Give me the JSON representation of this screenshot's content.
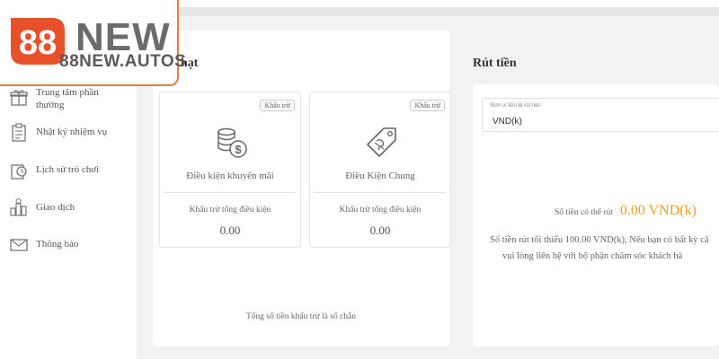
{
  "logo": {
    "number": "88",
    "word": "NEW",
    "domain": "88NEW.AUTOS",
    "brand_color": "#e8502a"
  },
  "sidebar": {
    "items": [
      {
        "label": "Trung tâm phần thưởng",
        "icon": "gift-icon"
      },
      {
        "label": "Nhật ký nhiệm vụ",
        "icon": "clipboard-icon"
      },
      {
        "label": "Lịch sử trò chơi",
        "icon": "history-icon"
      },
      {
        "label": "Giao dịch",
        "icon": "transaction-icon"
      },
      {
        "label": "Thông báo",
        "icon": "mail-icon"
      }
    ]
  },
  "left_panel": {
    "title_fragment": "hạt",
    "cards": [
      {
        "tag": "Khấu trừ",
        "title": "Điều kiện khuyến mãi",
        "sub": "Khấu trừ tổng điều kiện",
        "value": "0.00",
        "icon": "coins-dollar-icon"
      },
      {
        "tag": "Khấu trừ",
        "title": "Điều Kiện Chung",
        "sub": "Khấu trừ tổng điều kiện",
        "value": "0.00",
        "icon": "price-tag-icon"
      }
    ],
    "footnote": "Tổng số tiền khấu trừ là số chẵn"
  },
  "right_panel": {
    "title": "Rút tiền",
    "currency_select": {
      "label": "Đơn vị tiền tệ rút tiền",
      "value": "VND(k)"
    },
    "available_label": "Số tiền có thể rút",
    "available_amount": "0.00 VND(k)",
    "min_line1": "Số tiền rút tối thiểu 100.00 VND(k), Nếu bạn có bất kỳ câ",
    "min_line2": "vui lòng liên hệ với bộ phận chăm sóc khách hà"
  },
  "colors": {
    "accent": "#f0a020",
    "logo_border": "#f07a3a"
  }
}
